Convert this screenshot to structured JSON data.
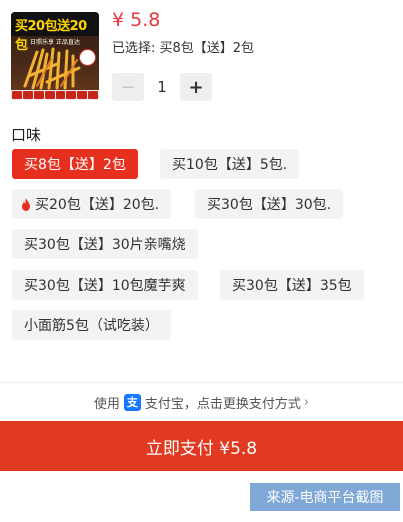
{
  "product": {
    "image_text": "买20包送20包",
    "image_subtext": "日照乐享 正品直达",
    "price": "¥ 5.8",
    "selected": "已选择: 买8包【送】2包"
  },
  "quantity": {
    "minus": "−",
    "value": "1",
    "plus": "+"
  },
  "flavor": {
    "title": "口味",
    "options": [
      "买8包【送】2包",
      "买10包【送】5包.",
      "买20包【送】20包.",
      "买30包【送】30包.",
      "买30包【送】30片亲嘴烧",
      "买30包【送】10包魔芋爽",
      "买30包【送】35包",
      "小面筋5包（试吃装）"
    ],
    "selected_index": 0
  },
  "payment": {
    "prefix": "使用",
    "method_icon": "支",
    "method": "支付宝，点击更换支付方式",
    "chevron": "›",
    "pay_button": "立即支付 ¥5.8"
  },
  "watermark": "来源-电商平台截图",
  "colors": {
    "accent": "#e62f1e",
    "price": "#e4393c",
    "alipay": "#1677ff"
  }
}
